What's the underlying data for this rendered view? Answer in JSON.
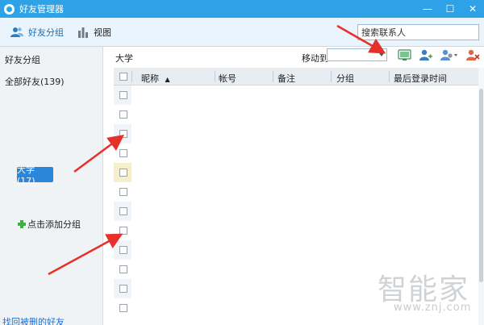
{
  "window": {
    "title": "好友管理器",
    "min_glyph": "—",
    "max_glyph": "☐",
    "close_glyph": "✕"
  },
  "toolbar": {
    "friend_groups_label": "好友分组",
    "view_label": "视图",
    "search_placeholder": "搜索联系人"
  },
  "sidebar": {
    "header": "好友分组",
    "all_friends": "全部好友(139)",
    "groups": [
      {
        "label": "大学 (17)",
        "selected": true
      }
    ],
    "add_group_label": "点击添加分组",
    "recover_link": "找回被删的好友"
  },
  "main": {
    "current_group": "大学",
    "move_to_label": "移动到",
    "move_to_value": "",
    "columns": [
      {
        "label": "昵称",
        "sort": "asc"
      },
      {
        "label": "帐号"
      },
      {
        "label": "备注"
      },
      {
        "label": "分组"
      },
      {
        "label": "最后登录时间"
      }
    ],
    "row_count": 12
  },
  "watermark": {
    "text": "智能家",
    "url": "www.znj.com"
  },
  "colors": {
    "titlebar": "#2ea2e6",
    "accent": "#2b86d9",
    "annotation_arrow": "#e8302a",
    "selected_row": "#f7efc9"
  }
}
